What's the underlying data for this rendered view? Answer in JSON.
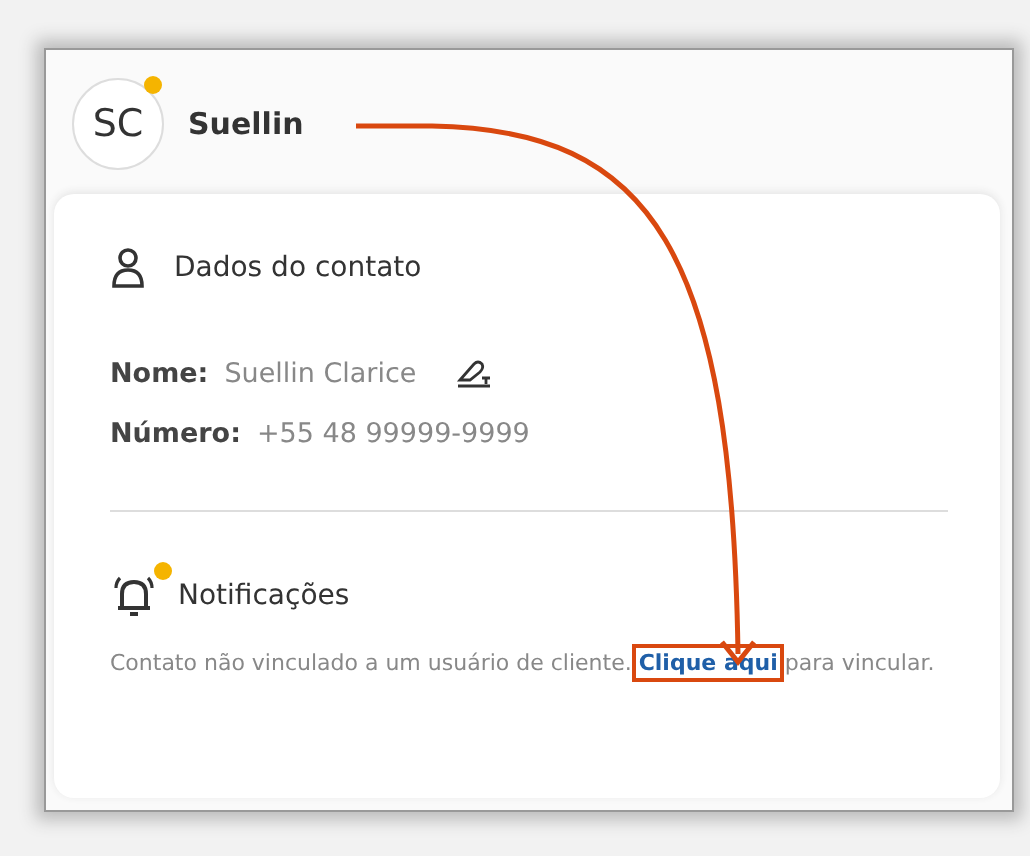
{
  "contact_header": {
    "initials": "SC",
    "name": "Suellin",
    "online": true
  },
  "contact_section": {
    "title": "Dados do contato",
    "fields": [
      {
        "label": "Nome:",
        "value": "Suellin Clarice",
        "editable": true
      },
      {
        "label": "Número:",
        "value": "+55 48 99999-9999",
        "editable": false
      }
    ]
  },
  "notifications": {
    "title": "Notificações",
    "unread": true,
    "message": {
      "before": "Contato não vinculado a um usuário de cliente.",
      "link": "Clique aqui",
      "after": "para vincular.",
      "highlighted": true
    }
  }
}
